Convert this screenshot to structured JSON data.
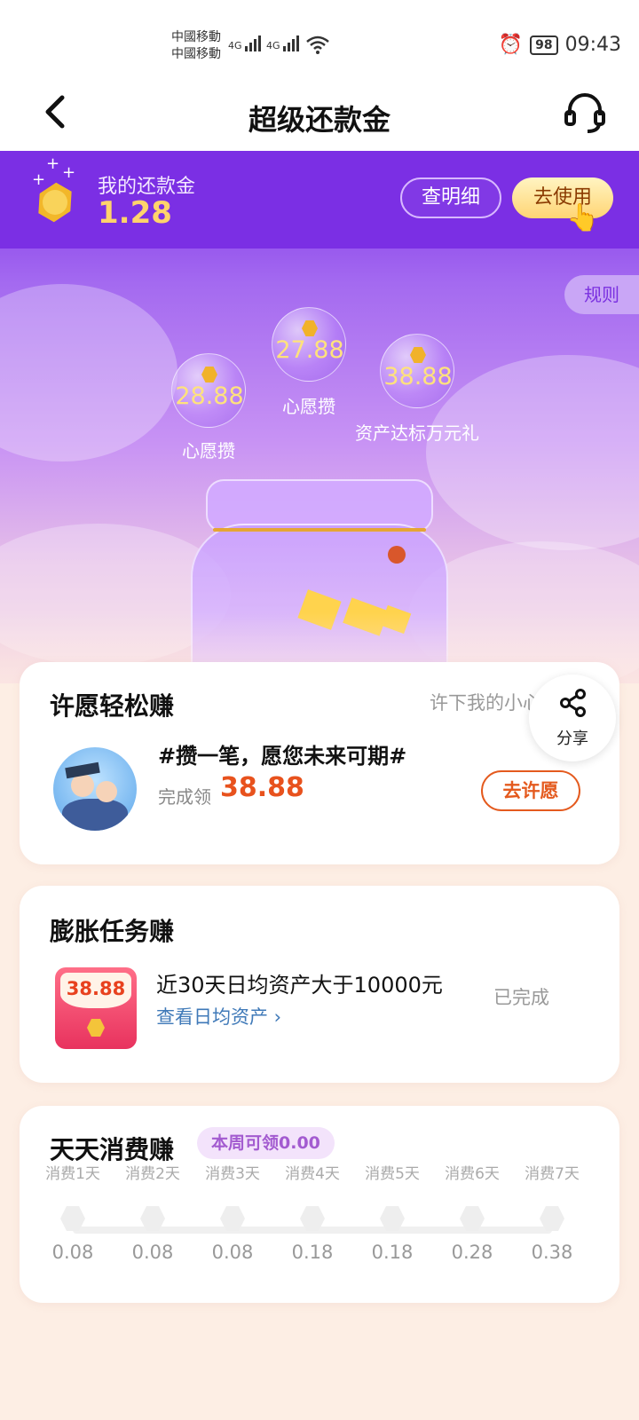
{
  "status_bar": {
    "carrier_1": "中國移動",
    "carrier_2": "中國移動",
    "network_1": "4G",
    "network_2": "4G",
    "battery": "98",
    "time": "09:43"
  },
  "nav": {
    "title": "超级还款金"
  },
  "balance": {
    "label": "我的还款金",
    "value": "1.28",
    "detail_button": "查明细",
    "use_button": "去使用",
    "rules_button": "规则"
  },
  "bubbles": [
    {
      "value": "28.88",
      "label": "心愿攒"
    },
    {
      "value": "27.88",
      "label": "心愿攒"
    },
    {
      "value": "38.88",
      "label": "资产达标万元礼"
    }
  ],
  "wish_card": {
    "title": "许愿轻松赚",
    "hint": "许下我的小心愿",
    "share_label": "分享",
    "task_title": "#攒一笔，愿您未来可期#",
    "reward_label": "完成领",
    "reward_value": "38.88",
    "button": "去许愿"
  },
  "expand_card": {
    "title": "膨胀任务赚",
    "packet_value": "38.88",
    "task_title": "近30天日均资产大于10000元",
    "link": "查看日均资产 ›",
    "status": "已完成"
  },
  "daily_card": {
    "title": "天天消费赚",
    "badge": "本周可领0.00",
    "days": [
      {
        "label": "消费1天",
        "value": "0.08"
      },
      {
        "label": "消费2天",
        "value": "0.08"
      },
      {
        "label": "消费3天",
        "value": "0.08"
      },
      {
        "label": "消费4天",
        "value": "0.18"
      },
      {
        "label": "消费5天",
        "value": "0.18"
      },
      {
        "label": "消费6天",
        "value": "0.28"
      },
      {
        "label": "消费7天",
        "value": "0.38"
      }
    ]
  },
  "colors": {
    "brand_purple": "#7b2fe4",
    "accent_orange": "#e8521d",
    "gold": "#ffd36b"
  }
}
